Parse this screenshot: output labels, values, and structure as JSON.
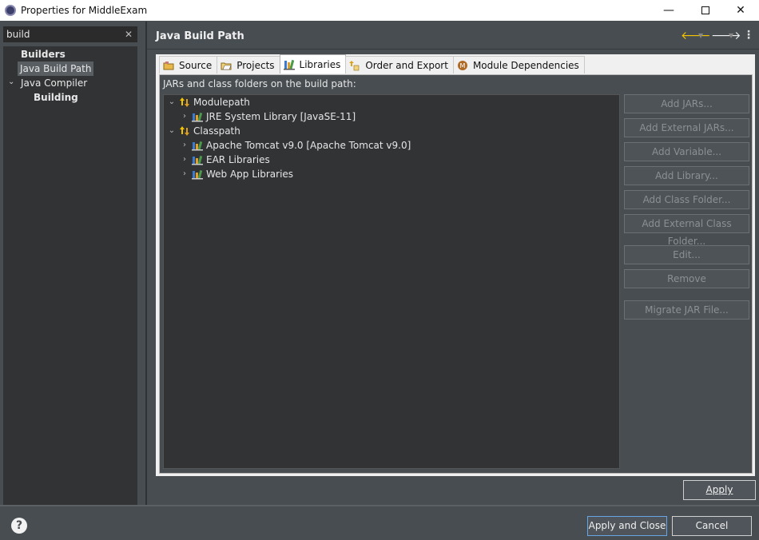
{
  "window": {
    "title": "Properties for MiddleExam",
    "minimize": "—",
    "close": "✕"
  },
  "left": {
    "filter_value": "build",
    "clear_glyph": "✕",
    "items": [
      {
        "label": "Builders"
      },
      {
        "label": "Java Build Path"
      },
      {
        "label": "Java Compiler"
      },
      {
        "label": "Building"
      }
    ]
  },
  "page": {
    "title": "Java Build Path",
    "menu_glyph": "⋮",
    "back_glyph": "🡐",
    "forward_glyph": "🡒",
    "dropdown_glyph": "▼"
  },
  "tabs": [
    {
      "label": "Source"
    },
    {
      "label": "Projects"
    },
    {
      "label": "Libraries"
    },
    {
      "label": "Order and Export"
    },
    {
      "label": "Module Dependencies"
    }
  ],
  "libraries": {
    "caption": "JARs and class folders on the build path:",
    "tree": [
      {
        "label": "Modulepath"
      },
      {
        "label": "JRE System Library [JavaSE-11]"
      },
      {
        "label": "Classpath"
      },
      {
        "label": "Apache Tomcat v9.0 [Apache Tomcat v9.0]"
      },
      {
        "label": "EAR Libraries"
      },
      {
        "label": "Web App Libraries"
      }
    ],
    "buttons": {
      "add_jars": "Add JARs...",
      "add_external_jars": "Add External JARs...",
      "add_variable": "Add Variable...",
      "add_library": "Add Library...",
      "add_class_folder": "Add Class Folder...",
      "add_external_class_folder": "Add External Class Folder...",
      "edit": "Edit...",
      "remove": "Remove",
      "migrate_jar": "Migrate JAR File..."
    }
  },
  "footer": {
    "apply": "Apply",
    "apply_and_close": "Apply and Close",
    "cancel": "Cancel",
    "help_glyph": "?"
  },
  "colors": {
    "accent": "#f5c400",
    "panel_dark": "#313335",
    "background": "#474d51",
    "focus_border": "#66a6e6"
  }
}
